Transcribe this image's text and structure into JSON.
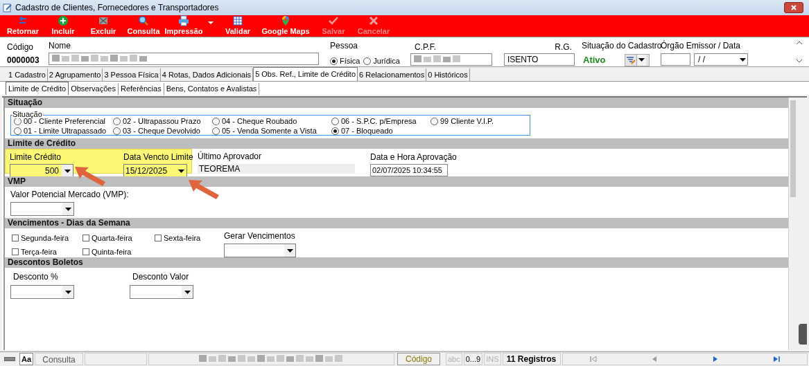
{
  "window": {
    "title": "Cadastro de Clientes, Fornecedores e Transportadores"
  },
  "toolbar": [
    {
      "label": "Retornar",
      "kind": "return",
      "disabled": false
    },
    {
      "label": "Incluir",
      "kind": "add",
      "disabled": false
    },
    {
      "label": "Excluir",
      "kind": "delete",
      "disabled": false
    },
    {
      "label": "Consulta",
      "kind": "search",
      "disabled": false
    },
    {
      "label": "Impressão",
      "kind": "print",
      "disabled": false
    },
    {
      "kind": "menu",
      "disabled": false
    },
    {
      "label": "Validar",
      "kind": "validate",
      "disabled": false
    },
    {
      "label": "Google Maps",
      "kind": "map",
      "disabled": false
    },
    {
      "label": "Salvar",
      "kind": "save",
      "disabled": true
    },
    {
      "label": "Cancelar",
      "kind": "cancel",
      "disabled": true
    }
  ],
  "header": {
    "codigo_label": "Código",
    "codigo": "0000003",
    "nome_label": "Nome",
    "pessoa_label": "Pessoa",
    "pessoa_options": [
      {
        "label": "Física",
        "selected": true
      },
      {
        "label": "Jurídica",
        "selected": false
      }
    ],
    "cpf_label": "C.P.F.",
    "rg_label": "R.G.",
    "rg": "ISENTO",
    "situacao_label": "Situação do Cadastro",
    "situacao": "Ativo",
    "orgao_label": "Órgão Emissor",
    "data_label": "/ Data",
    "data": "/ /"
  },
  "tabs": [
    {
      "label": "1 Cadastro",
      "selected": false
    },
    {
      "label": "2 Agrupamento",
      "selected": false
    },
    {
      "label": "3 Pessoa Física",
      "selected": false
    },
    {
      "label": "4 Rotas, Dados Adicionais",
      "selected": false
    },
    {
      "label": "5 Obs. Ref., Limite de Crédito",
      "selected": true
    },
    {
      "label": "6 Relacionamentos",
      "selected": false
    },
    {
      "label": "0 Históricos",
      "selected": false
    }
  ],
  "subtabs": [
    {
      "label": "Limite de Crédito",
      "selected": true
    },
    {
      "label": "Observações",
      "selected": false
    },
    {
      "label": "Referências",
      "selected": false
    },
    {
      "label": "Bens, Contatos e Avalistas",
      "selected": false
    }
  ],
  "situacao": {
    "title": "Situação",
    "group_label": "Situação",
    "options": [
      {
        "label": "00 - Cliente Preferencial",
        "selected": false
      },
      {
        "label": "02 - Ultrapassou Prazo",
        "selected": false
      },
      {
        "label": "04 - Cheque Roubado",
        "selected": false
      },
      {
        "label": "06 - S.P.C. p/Empresa",
        "selected": false
      },
      {
        "label": "99 Cliente V.I.P.",
        "selected": false
      },
      {
        "label": "01 - Limite Ultrapassado",
        "selected": false
      },
      {
        "label": "03 - Cheque Devolvido",
        "selected": false
      },
      {
        "label": "05 - Venda Somente a Vista",
        "selected": false
      },
      {
        "label": "07 - Bloqueado",
        "selected": true
      }
    ]
  },
  "limite": {
    "title": "Limite de Crédito",
    "highlighted": true,
    "limite_label": "Limite Crédito",
    "limite": "500",
    "vencto_label": "Data Vencto Limite",
    "vencto": "15/12/2025",
    "aprovador_label": "Último Aprovador",
    "aprovador": "TEOREMA",
    "data_hora_label": "Data e Hora Aprovação",
    "data_hora": "02/07/2025 10:34:55"
  },
  "vmp": {
    "title": "VMP",
    "label": "Valor Potencial Mercado (VMP):"
  },
  "vencimentos": {
    "title": "Vencimentos - Dias da Semana",
    "days": [
      {
        "label": "Segunda-feira",
        "checked": false
      },
      {
        "label": "Terça-feira",
        "checked": false
      },
      {
        "label": "Quarta-feira",
        "checked": false
      },
      {
        "label": "Quinta-feira",
        "checked": false
      },
      {
        "label": "Sexta-feira",
        "checked": false
      }
    ],
    "gerar_label": "Gerar Vencimentos"
  },
  "descontos": {
    "title": "Descontos Boletos",
    "percent_label": "Desconto %",
    "valor_label": "Desconto Valor"
  },
  "status_bar": {
    "font_button": "Aa",
    "mode": "Consulta",
    "order": "Código",
    "indicators": [
      {
        "label": "abc",
        "disabled": true
      },
      {
        "label": "0...9",
        "disabled": false
      },
      {
        "label": "INS",
        "disabled": true
      }
    ],
    "records": "11 Registros",
    "nav": [
      {
        "kind": "first",
        "disabled": true
      },
      {
        "kind": "prev",
        "disabled": true
      },
      {
        "kind": "next",
        "disabled": false
      },
      {
        "kind": "last",
        "disabled": false
      }
    ]
  }
}
